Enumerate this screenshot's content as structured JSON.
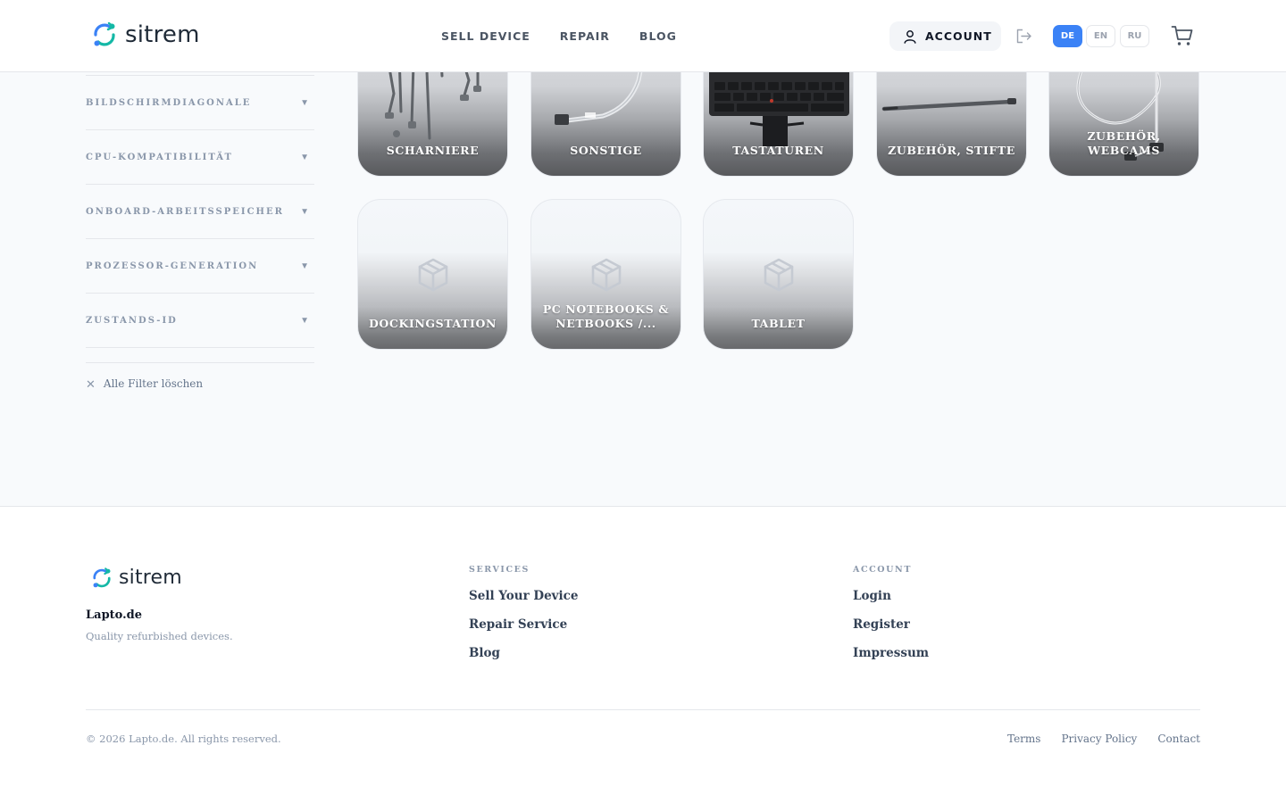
{
  "header": {
    "logo_text": "sitrem",
    "nav": [
      {
        "label": "SELL DEVICE"
      },
      {
        "label": "REPAIR"
      },
      {
        "label": "BLOG"
      }
    ],
    "account_label": "ACCOUNT",
    "languages": [
      {
        "code": "DE",
        "active": true
      },
      {
        "code": "EN",
        "active": false
      },
      {
        "code": "RU",
        "active": false
      }
    ],
    "icons": {
      "account": "user-icon",
      "logout": "logout-icon",
      "cart": "cart-icon"
    }
  },
  "sidebar": {
    "filters": [
      {
        "label": "BILDSCHIRMDIAGONALE"
      },
      {
        "label": "CPU-KOMPATIBILITÄT"
      },
      {
        "label": "ONBOARD-ARBEITSSPEICHER"
      },
      {
        "label": "PROZESSOR-GENERATION"
      },
      {
        "label": "ZUSTANDS-ID"
      }
    ],
    "clear_label": "Alle Filter löschen"
  },
  "categories": [
    {
      "label": "SCHARNIERE",
      "has_image": true,
      "image": "hinges"
    },
    {
      "label": "SONSTIGE",
      "has_image": true,
      "image": "cable"
    },
    {
      "label": "TASTATUREN",
      "has_image": true,
      "image": "keyboard"
    },
    {
      "label": "ZUBEHÖR, STIFTE",
      "has_image": true,
      "image": "stylus"
    },
    {
      "label": "ZUBEHÖR, WEBCAMS",
      "has_image": true,
      "image": "webcam"
    },
    {
      "label": "DOCKINGSTATION",
      "has_image": false
    },
    {
      "label": "PC NOTEBOOKS & NETBOOKS /...",
      "has_image": false
    },
    {
      "label": "TABLET",
      "has_image": false
    }
  ],
  "footer": {
    "logo_text": "sitrem",
    "brand": "Lapto.de",
    "tagline": "Quality refurbished devices.",
    "services": {
      "title": "SERVICES",
      "links": [
        {
          "label": "Sell Your Device"
        },
        {
          "label": "Repair Service"
        },
        {
          "label": "Blog"
        }
      ]
    },
    "account": {
      "title": "ACCOUNT",
      "links": [
        {
          "label": "Login"
        },
        {
          "label": "Register"
        },
        {
          "label": "Impressum"
        }
      ]
    },
    "copyright": "© 2026 Lapto.de. All rights reserved.",
    "legal": [
      {
        "label": "Terms"
      },
      {
        "label": "Privacy Policy"
      },
      {
        "label": "Contact"
      }
    ]
  },
  "colors": {
    "accent": "#3b82f6",
    "logo_teal": "#14b8a6",
    "logo_blue": "#3b82f6",
    "text_dark": "#111827",
    "text_muted": "#8a97aa"
  }
}
